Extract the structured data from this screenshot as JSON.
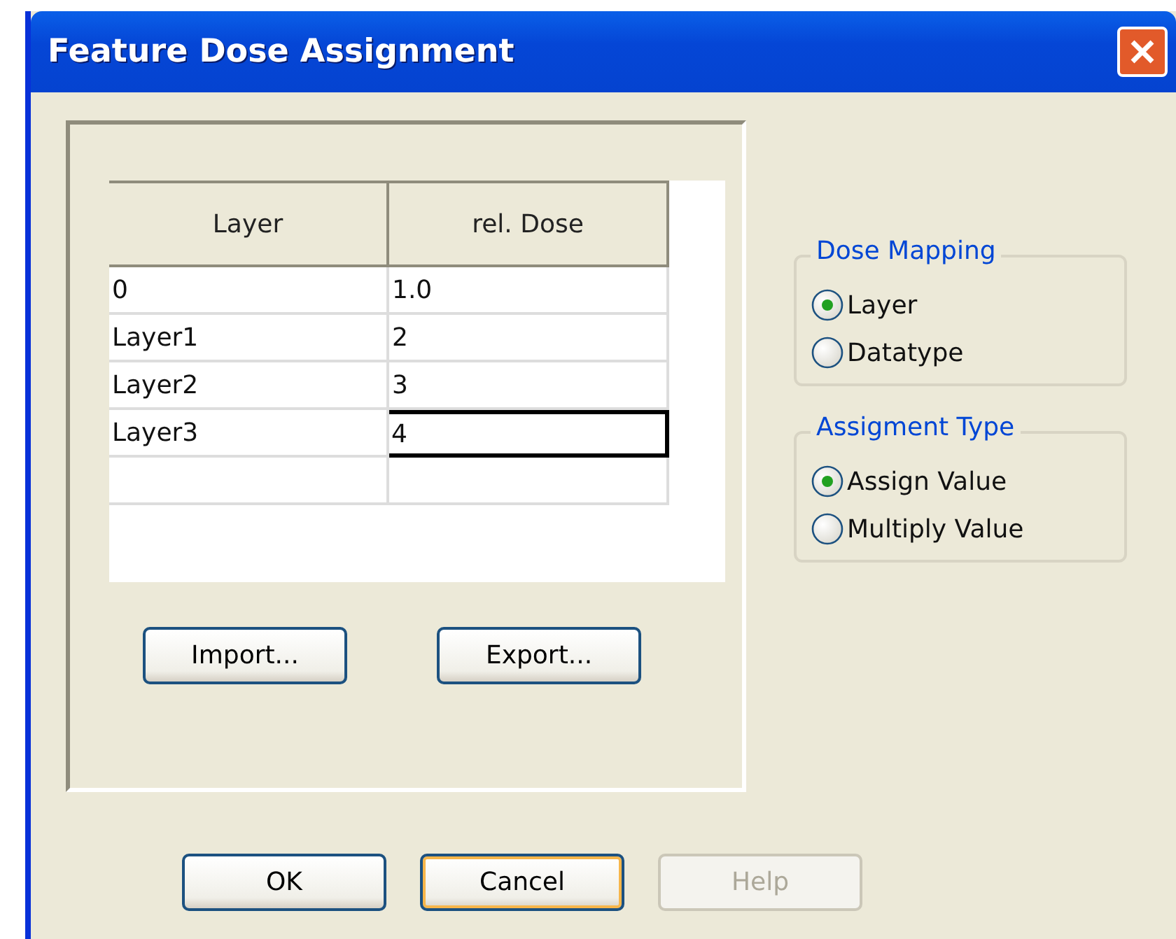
{
  "window": {
    "title": "Feature Dose Assignment"
  },
  "table": {
    "columns": [
      "Layer",
      "rel. Dose"
    ],
    "rows": [
      {
        "kind": "data",
        "cells": [
          {
            "text": "0",
            "focused": false
          },
          {
            "text": "1.0",
            "focused": false
          }
        ]
      },
      {
        "kind": "data",
        "cells": [
          {
            "text": "Layer1",
            "focused": false
          },
          {
            "text": "2",
            "focused": false
          }
        ]
      },
      {
        "kind": "data",
        "cells": [
          {
            "text": "Layer2",
            "focused": false
          },
          {
            "text": "3",
            "focused": false
          }
        ]
      },
      {
        "kind": "data",
        "cells": [
          {
            "text": "Layer3",
            "focused": false
          },
          {
            "text": "4",
            "focused": true
          }
        ]
      },
      {
        "kind": "blank"
      }
    ]
  },
  "panel_buttons": [
    {
      "label": "Import...",
      "disabled": false,
      "focused": false
    },
    {
      "label": "Export...",
      "disabled": false,
      "focused": false
    }
  ],
  "groups": [
    {
      "title": "Dose Mapping",
      "options": [
        {
          "label": "Layer",
          "selected": true
        },
        {
          "label": "Datatype",
          "selected": false
        }
      ]
    },
    {
      "title": "Assigment Type",
      "options": [
        {
          "label": "Assign Value",
          "selected": true
        },
        {
          "label": "Multiply Value",
          "selected": false
        }
      ]
    }
  ],
  "buttons": [
    {
      "label": "OK",
      "disabled": false,
      "focused": false
    },
    {
      "label": "Cancel",
      "disabled": false,
      "focused": true
    },
    {
      "label": "Help",
      "disabled": true,
      "focused": false
    }
  ]
}
